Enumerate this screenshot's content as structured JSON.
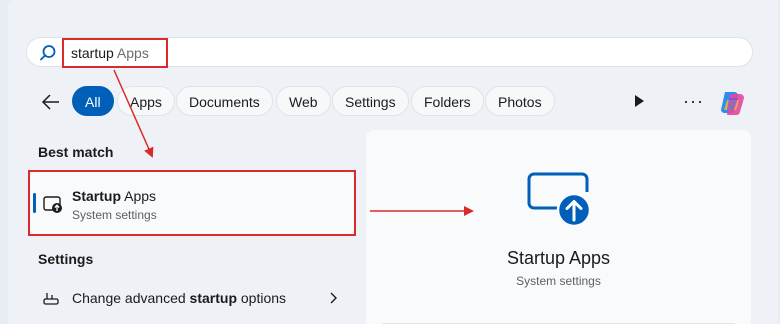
{
  "search": {
    "query_bold": "startup",
    "query_rest": " Apps"
  },
  "filters": [
    "All",
    "Apps",
    "Documents",
    "Web",
    "Settings",
    "Folders",
    "Photos"
  ],
  "best_match": {
    "heading": "Best match",
    "name_bold": "Startup",
    "name_rest": " Apps",
    "subtitle": "System settings"
  },
  "settings_section": {
    "heading": "Settings",
    "item_pre": "Change advanced ",
    "item_bold": "startup",
    "item_post": " options"
  },
  "detail": {
    "title": "Startup Apps",
    "subtitle": "System settings"
  },
  "colors": {
    "accent": "#005fb8",
    "annotation": "#d92b2b"
  }
}
